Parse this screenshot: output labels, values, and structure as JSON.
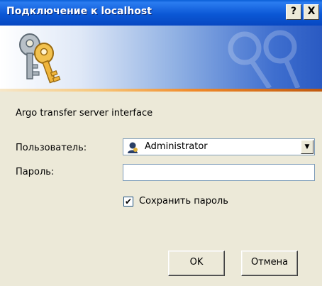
{
  "window": {
    "title": "Подключение к localhost",
    "help_label": "?",
    "close_label": "X"
  },
  "banner": {
    "icon": "keys-icon",
    "colors": {
      "banner_start": "#ffffff",
      "banner_end": "#2a5ac2",
      "stripe": "#f08a2a"
    }
  },
  "dialog": {
    "server_description": "Argo transfer server interface",
    "user_label": "Пользователь:",
    "user_value": "Administrator",
    "user_icon": "user-icon",
    "password_label": "Пароль:",
    "password_value": "",
    "save_password_label": "Сохранить пароль",
    "save_password_checked": true,
    "ok_label": "OK",
    "cancel_label": "Отмена"
  }
}
